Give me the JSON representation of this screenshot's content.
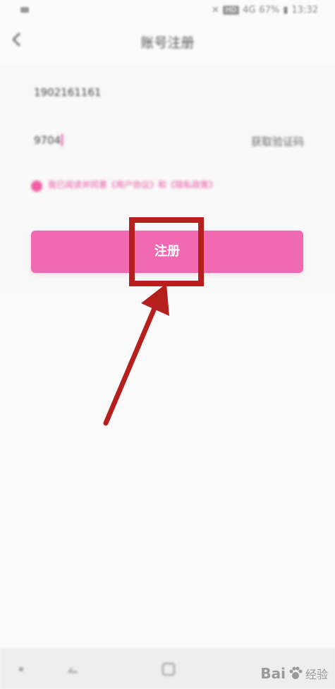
{
  "status_bar": {
    "hd": "HD",
    "signal": "4G",
    "battery": "67%",
    "time": "13:32"
  },
  "header": {
    "title": "账号注册"
  },
  "form": {
    "phone_value": "1902161161",
    "code_value": "9704",
    "get_code_label": "获取验证码",
    "agreement_text": "我已阅读并同意《用户协议》和《隐私政策》"
  },
  "register_button": {
    "label": "注册"
  },
  "colors": {
    "accent_pink": "#f06ab2",
    "annotation_red": "#b5201f"
  },
  "watermark": {
    "brand": "Bai",
    "suffix": "经验"
  }
}
